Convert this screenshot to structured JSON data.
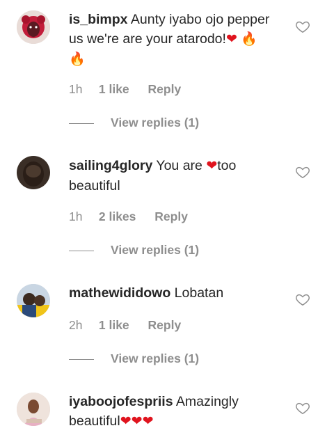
{
  "comments": [
    {
      "username": "is_bimpx",
      "text": "Aunty iyabo ojo pepper us we're are your atarodo!",
      "time": "1h",
      "likes": "1 like",
      "reply": "Reply",
      "view_replies": "View replies (1)"
    },
    {
      "username": "sailing4glory",
      "text_before": "You are ",
      "text_after": "too beautiful",
      "time": "1h",
      "likes": "2 likes",
      "reply": "Reply",
      "view_replies": "View replies (1)"
    },
    {
      "username": "mathewididowo",
      "text": "Lobatan",
      "time": "2h",
      "likes": "1 like",
      "reply": "Reply",
      "view_replies": "View replies (1)"
    },
    {
      "username": "iyaboojofespriis",
      "text": "Amazingly beautiful"
    }
  ],
  "icons": {
    "like": "heart-outline-icon",
    "emoji_heart": "red-heart-emoji",
    "emoji_fire": "fire-emoji"
  },
  "colors": {
    "primary_text": "#262626",
    "secondary_text": "#8e8e8e",
    "heart_red": "#e0141e"
  }
}
